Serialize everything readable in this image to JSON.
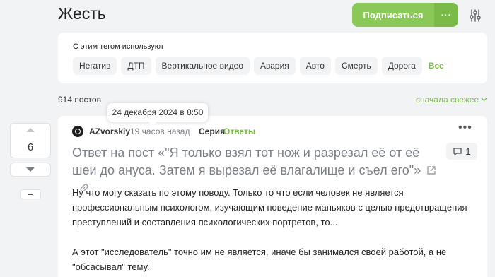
{
  "page": {
    "title": "Жесть"
  },
  "header": {
    "subscribe_label": "Подписаться",
    "more_label": "⋯",
    "accent_color": "#8ac858",
    "filter_icon": "sliders-icon"
  },
  "tags": {
    "caption": "С этим тегом используют",
    "items": [
      "Негатив",
      "ДТП",
      "Вертикальное видео",
      "Авария",
      "Авто",
      "Смерть",
      "Дорога"
    ],
    "all_label": "Все"
  },
  "feed": {
    "posts_count": "914 постов",
    "sort_label": "сначала свежее"
  },
  "post": {
    "rating": "6",
    "author": "AZvorskiy",
    "time": "19 часов назад",
    "time_tooltip": "24 декабря 2024 в 8:50",
    "series_label": "Серия",
    "series_name": "Ответы",
    "title": "Ответ на пост «\"Я только взял тот нож и разрезал её от её шеи до ануса. Затем я вырезал её влагалище и съел его\"»",
    "comments_count": "1",
    "body": [
      "Ну что могу сказать по этому поводу. Только то что если человек не является профессиональным психологом, изучающим поведение маньяков с целью предотвращения преступлений и составления психологических портретов, то...",
      "А этот \"исследователь\" точно им не является, иначе бы занимался своей работой, а не \"обсасывал\" тему."
    ]
  }
}
